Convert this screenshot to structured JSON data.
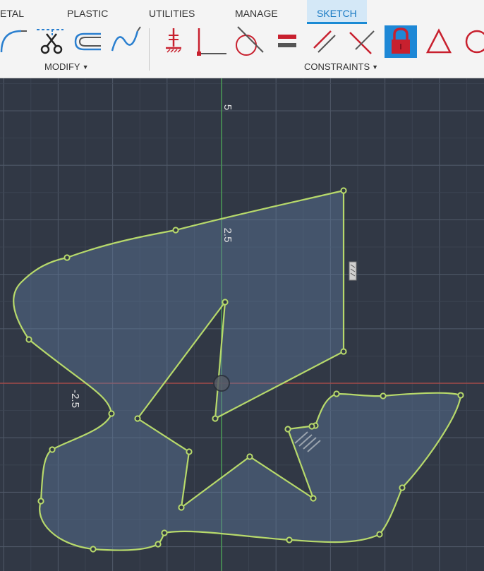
{
  "tabs": [
    {
      "label": "ETAL",
      "active": false
    },
    {
      "label": "PLASTIC",
      "active": false
    },
    {
      "label": "UTILITIES",
      "active": false
    },
    {
      "label": "MANAGE",
      "active": false
    },
    {
      "label": "SKETCH",
      "active": true
    }
  ],
  "groups": {
    "modify": {
      "label": "MODIFY"
    },
    "constraints": {
      "label": "CONSTRAINTS"
    }
  },
  "tools": {
    "fillet": "fillet-icon",
    "trim": "trim-icon",
    "offset": "offset-icon",
    "spline": "spline-icon",
    "horizontal_vertical": "horizontal-vertical-icon",
    "coincident": "coincident-icon",
    "tangent": "tangent-icon",
    "equal": "equal-icon",
    "parallel": "parallel-icon",
    "perpendicular": "perpendicular-icon",
    "fix": "lock-icon",
    "symmetry": "triangle-icon",
    "circle": "circle-icon"
  },
  "axis_labels": {
    "y_top": "5",
    "y_mid": "2.5",
    "x_neg": "-2.5"
  },
  "colors": {
    "toolbar_bg": "#f4f4f4",
    "canvas_bg": "#313845",
    "sketch_line": "#b7d96b",
    "constraint_red": "#c8202e",
    "accent_blue": "#1a8ad4",
    "lock_active_bg": "#1e88d6"
  }
}
